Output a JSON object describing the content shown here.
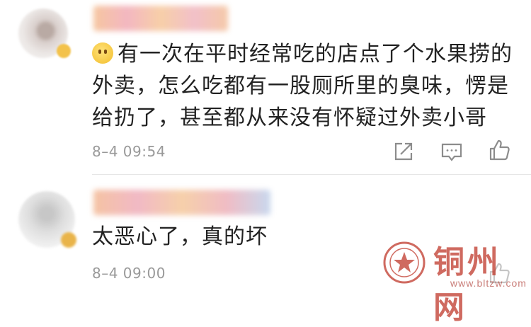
{
  "comments": [
    {
      "text": "有一次在平时经常吃的店点了个水果捞的外卖，怎么吃都有一股厕所里的臭味，愣是给扔了，甚至都从来没有怀疑过外卖小哥",
      "timestamp": "8–4 09:54",
      "leading_emoji": "thinking-face-emoji",
      "actions": [
        "share-icon",
        "reply-icon",
        "like-icon"
      ]
    },
    {
      "text": "太恶心了，真的坏",
      "timestamp": "8–4 09:00",
      "actions": [
        "like-icon"
      ]
    }
  ],
  "watermark": {
    "name": "铜州网",
    "url": "www.bltzw.com"
  },
  "colors": {
    "text": "#222222",
    "timestamp": "#999999",
    "icon": "#8c8c8c",
    "watermark": "#c0392b"
  }
}
